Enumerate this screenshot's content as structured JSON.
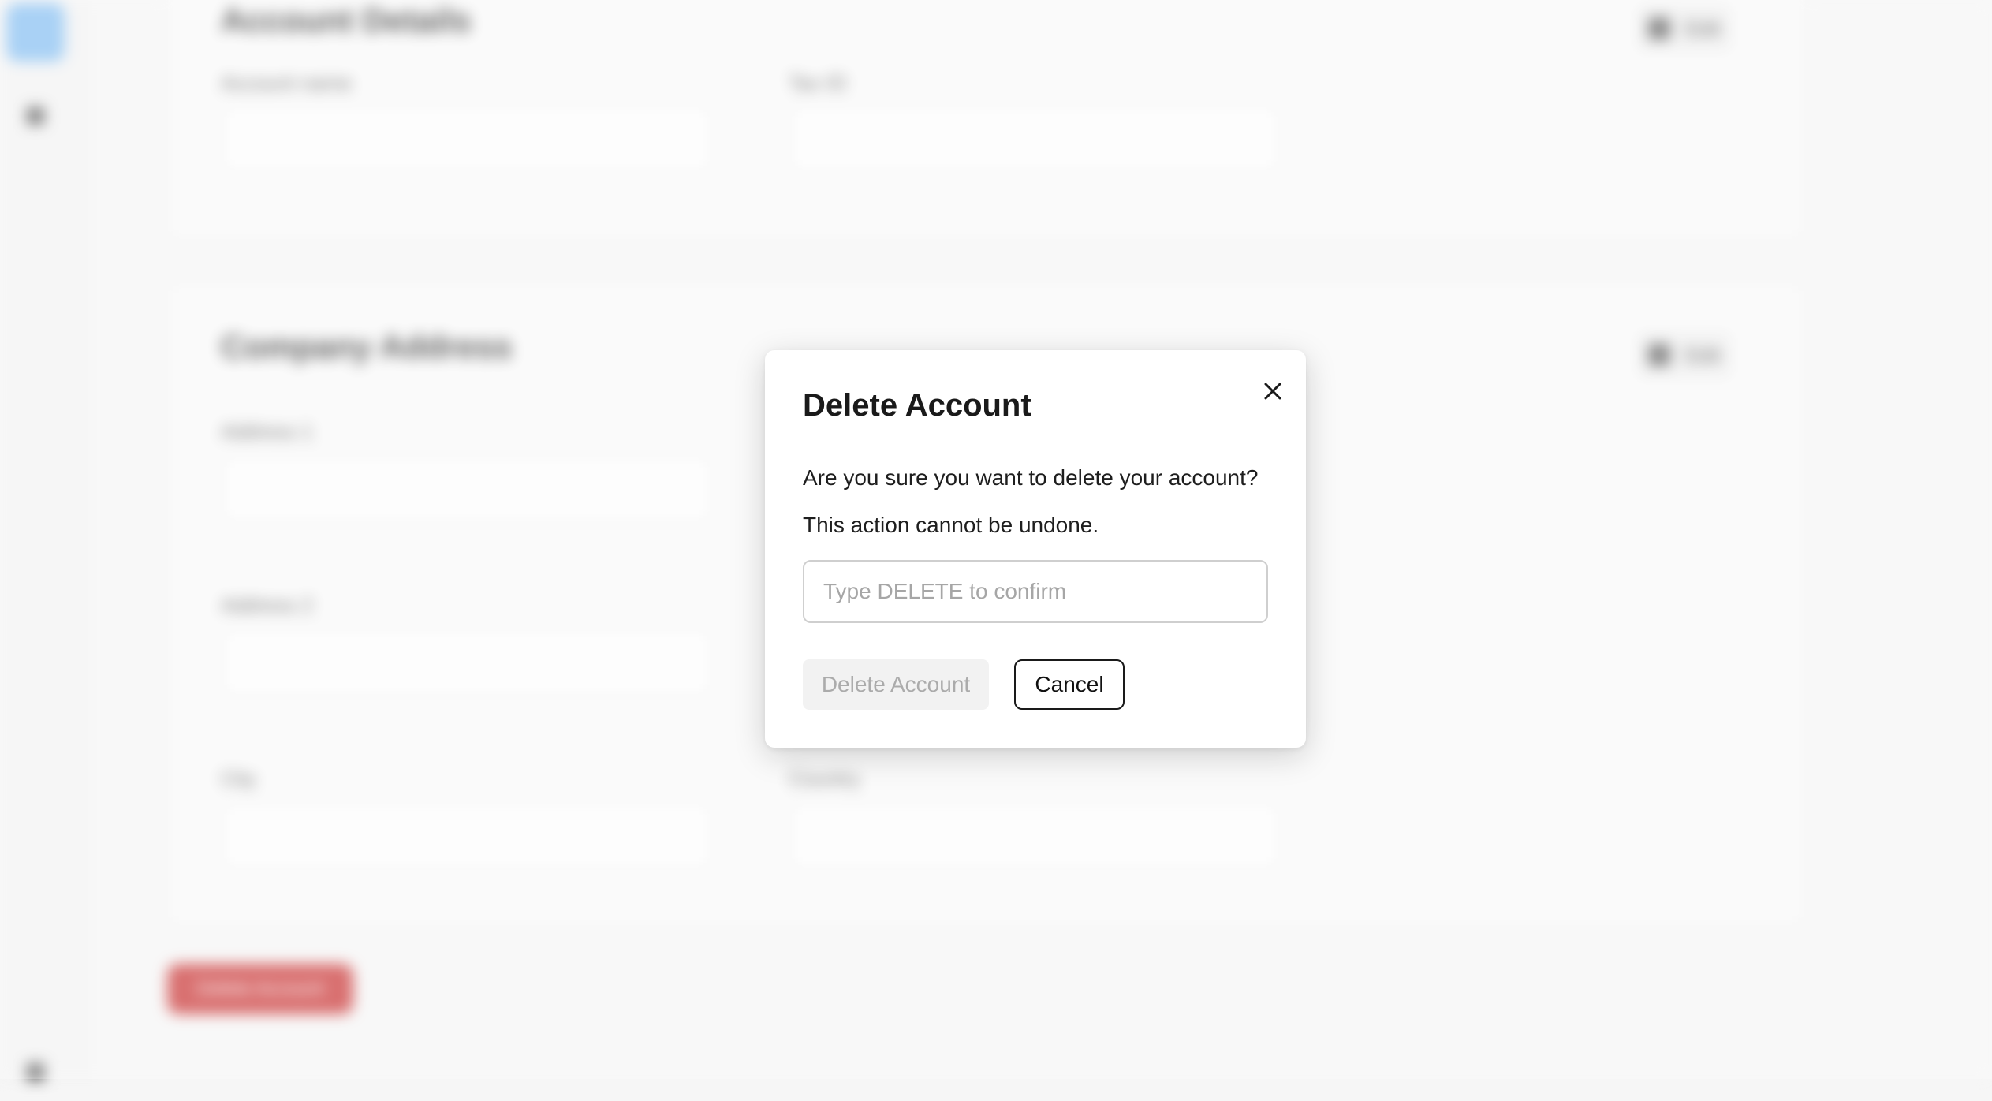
{
  "background": {
    "sidebar": {
      "items": [
        {
          "icon": "home-icon",
          "active": true
        },
        {
          "icon": "settings-icon",
          "active": false
        },
        {
          "icon": "user-icon",
          "active": false
        }
      ]
    },
    "account_details": {
      "title": "Account Details",
      "edit_label": "Edit",
      "fields": [
        {
          "label": "Account name"
        },
        {
          "label": "Tax ID"
        }
      ]
    },
    "company_address": {
      "title": "Company Address",
      "edit_label": "Edit",
      "fields": [
        {
          "label": "Address 1"
        },
        {
          "label": "Address 2"
        },
        {
          "label": "City"
        },
        {
          "label": "Country"
        }
      ]
    },
    "danger_button_label": "Delete Account"
  },
  "modal": {
    "title": "Delete Account",
    "message_line1": "Are you sure you want to delete your account?",
    "message_line2": "This action cannot be undone.",
    "input": {
      "value": "",
      "placeholder": "Type DELETE to confirm"
    },
    "delete_label": "Delete Account",
    "delete_enabled": false,
    "cancel_label": "Cancel",
    "close_icon": "close-icon"
  },
  "colors": {
    "sidebar_active": "#8cc2f2",
    "danger": "#cc4040",
    "disabled_text": "#ababab",
    "disabled_bg": "#f2f2f2"
  }
}
